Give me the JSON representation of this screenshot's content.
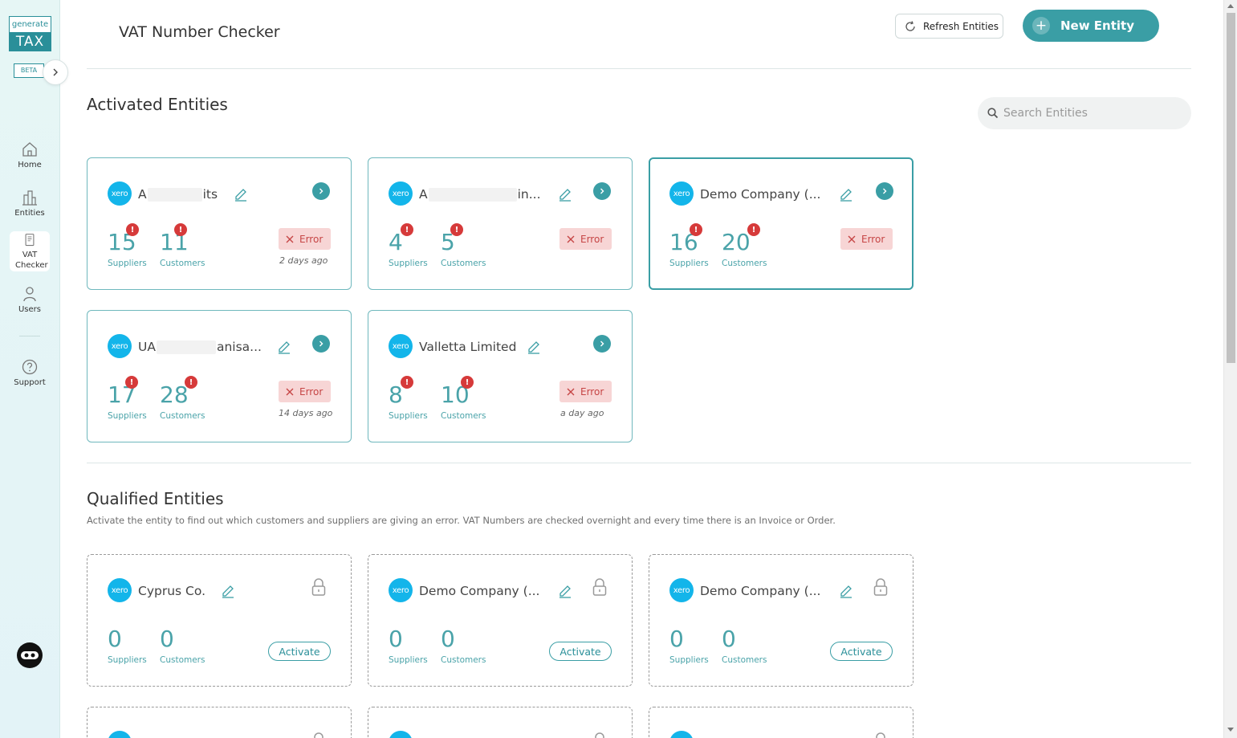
{
  "sidebar": {
    "logo_top": "generate",
    "logo_bottom": "TAX",
    "beta": "BETA",
    "items": [
      {
        "label": "Home"
      },
      {
        "label": "Entities"
      },
      {
        "label": "VAT Checker"
      },
      {
        "label": "Users"
      },
      {
        "label": "Support"
      }
    ]
  },
  "header": {
    "title": "VAT Number Checker",
    "refresh_label": "Refresh Entities",
    "new_entity_label": "New Entity"
  },
  "activated": {
    "title": "Activated Entities",
    "search_placeholder": "Search Entities",
    "cards": [
      {
        "logo": "xero",
        "name_start": "A",
        "name_end": "its",
        "suppliers": "15",
        "customers": "11",
        "suppliers_label": "Suppliers",
        "customers_label": "Customers",
        "status": "Error",
        "time": "2 days ago"
      },
      {
        "logo": "xero",
        "name_start": "A",
        "name_end": "in...",
        "suppliers": "4",
        "customers": "5",
        "suppliers_label": "Suppliers",
        "customers_label": "Customers",
        "status": "Error",
        "time": ""
      },
      {
        "logo": "xero",
        "name": "Demo Company (...",
        "suppliers": "16",
        "customers": "20",
        "suppliers_label": "Suppliers",
        "customers_label": "Customers",
        "status": "Error",
        "time": ""
      },
      {
        "logo": "xero",
        "name_start": "UA",
        "name_end": "anisa...",
        "suppliers": "17",
        "customers": "28",
        "suppliers_label": "Suppliers",
        "customers_label": "Customers",
        "status": "Error",
        "time": "14 days ago"
      },
      {
        "logo": "xero",
        "name": "Valletta Limited",
        "suppliers": "8",
        "customers": "10",
        "suppliers_label": "Suppliers",
        "customers_label": "Customers",
        "status": "Error",
        "time": "a day ago"
      }
    ]
  },
  "qualified": {
    "title": "Qualified Entities",
    "description": "Activate the entity to find out which customers and suppliers are giving an error. VAT Numbers are checked overnight and every time there is an Invoice or Order.",
    "cards": [
      {
        "logo": "xero",
        "name": "Cyprus Co.",
        "suppliers": "0",
        "customers": "0",
        "suppliers_label": "Suppliers",
        "customers_label": "Customers",
        "action": "Activate"
      },
      {
        "logo": "xero",
        "name": "Demo Company (...",
        "suppliers": "0",
        "customers": "0",
        "suppliers_label": "Suppliers",
        "customers_label": "Customers",
        "action": "Activate"
      },
      {
        "logo": "xero",
        "name": "Demo Company (...",
        "suppliers": "0",
        "customers": "0",
        "suppliers_label": "Suppliers",
        "customers_label": "Customers",
        "action": "Activate"
      }
    ]
  },
  "badge_symbol": "!",
  "colors": {
    "accent": "#3a9ea5",
    "error": "#d63a3a",
    "xero": "#13b5ea"
  }
}
